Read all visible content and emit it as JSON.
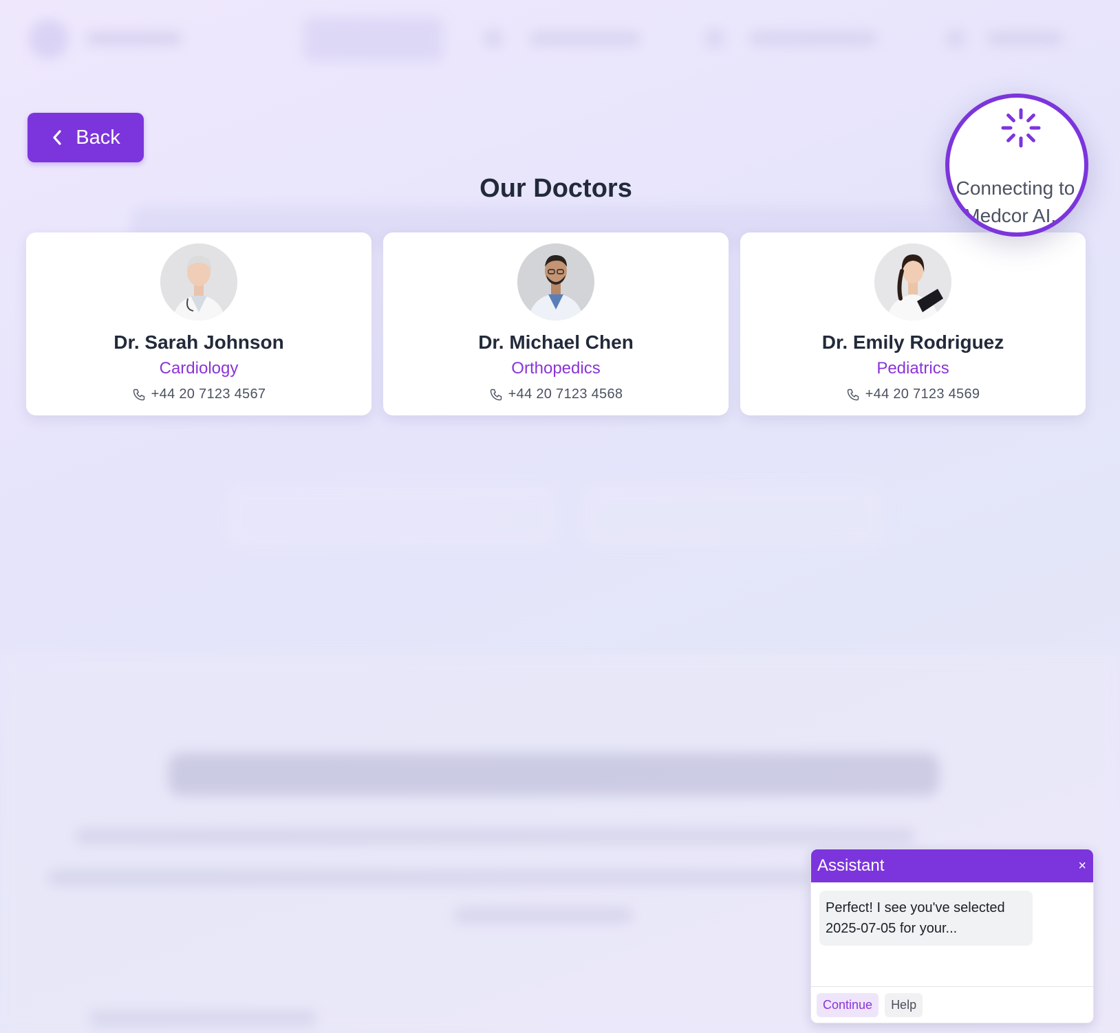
{
  "back_button": {
    "label": "Back"
  },
  "page": {
    "title": "Our Doctors"
  },
  "doctors": [
    {
      "name": "Dr. Sarah Johnson",
      "specialty": "Cardiology",
      "phone": "+44 20 7123 4567"
    },
    {
      "name": "Dr. Michael Chen",
      "specialty": "Orthopedics",
      "phone": "+44 20 7123 4568"
    },
    {
      "name": "Dr. Emily Rodriguez",
      "specialty": "Pediatrics",
      "phone": "+44 20 7123 4569"
    }
  ],
  "connecting": {
    "text": "Connecting to Medcor AI..."
  },
  "assistant": {
    "title": "Assistant",
    "close_label": "×",
    "message": "Perfect! I see you've selected 2025-07-05 for your...",
    "actions": {
      "continue_label": "Continue",
      "help_label": "Help"
    }
  },
  "theme": {
    "accent": "#7c35dc",
    "specialty_color": "#8a34d8",
    "title_color": "#222a3a"
  }
}
